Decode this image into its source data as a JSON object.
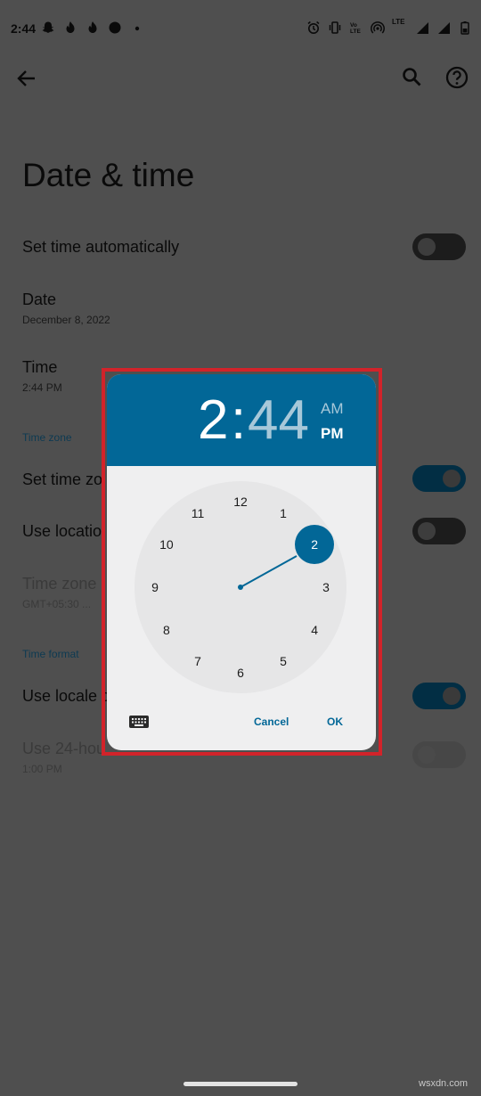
{
  "status_bar": {
    "time": "2:44",
    "left_icons": [
      "snapchat-icon",
      "tinder-icon",
      "tinder-icon",
      "notification-dot-icon",
      "more-dot-icon"
    ],
    "right_icons": [
      "alarm-icon",
      "vibrate-icon",
      "volte-icon",
      "hotspot-icon",
      "lte-signal-icon",
      "wifi-signal-icon",
      "battery-icon"
    ],
    "network_label": "LTE"
  },
  "app_bar": {
    "icons": [
      "back-arrow-icon",
      "search-icon",
      "help-icon"
    ]
  },
  "page": {
    "title": "Date & time"
  },
  "settings": {
    "set_time_automatically": {
      "title": "Set time automatically",
      "switch_state": "off"
    },
    "date": {
      "title": "Date",
      "summary": "December 8, 2022"
    },
    "time": {
      "title": "Time",
      "summary": "2:44 PM"
    },
    "time_zone_header": "Time zone",
    "set_time_zone_automatically": {
      "title": "Set time zo",
      "switch_state": "on"
    },
    "use_location": {
      "title": "Use locatio",
      "switch_state": "off"
    },
    "time_zone": {
      "title": "Time zone",
      "summary": "GMT+05:30 ..."
    },
    "time_format_header": "Time format",
    "use_locale_default": {
      "title": "Use locale d",
      "switch_state": "on"
    },
    "use_24_hour": {
      "title": "Use 24-hou",
      "summary": "1:00 PM",
      "switch_state": "disabled"
    }
  },
  "time_picker": {
    "hour": "2",
    "separator": ":",
    "minute": "44",
    "am_label": "AM",
    "pm_label": "PM",
    "selected_period": "PM",
    "selected_hour": "2",
    "clock_numbers": [
      "12",
      "1",
      "2",
      "3",
      "4",
      "5",
      "6",
      "7",
      "8",
      "9",
      "10",
      "11"
    ],
    "keyboard_icon": "keyboard-icon",
    "cancel_label": "Cancel",
    "ok_label": "OK",
    "accent_color": "#026797",
    "highlight_color": "#d2232a"
  },
  "watermark": "wsxdn.com"
}
